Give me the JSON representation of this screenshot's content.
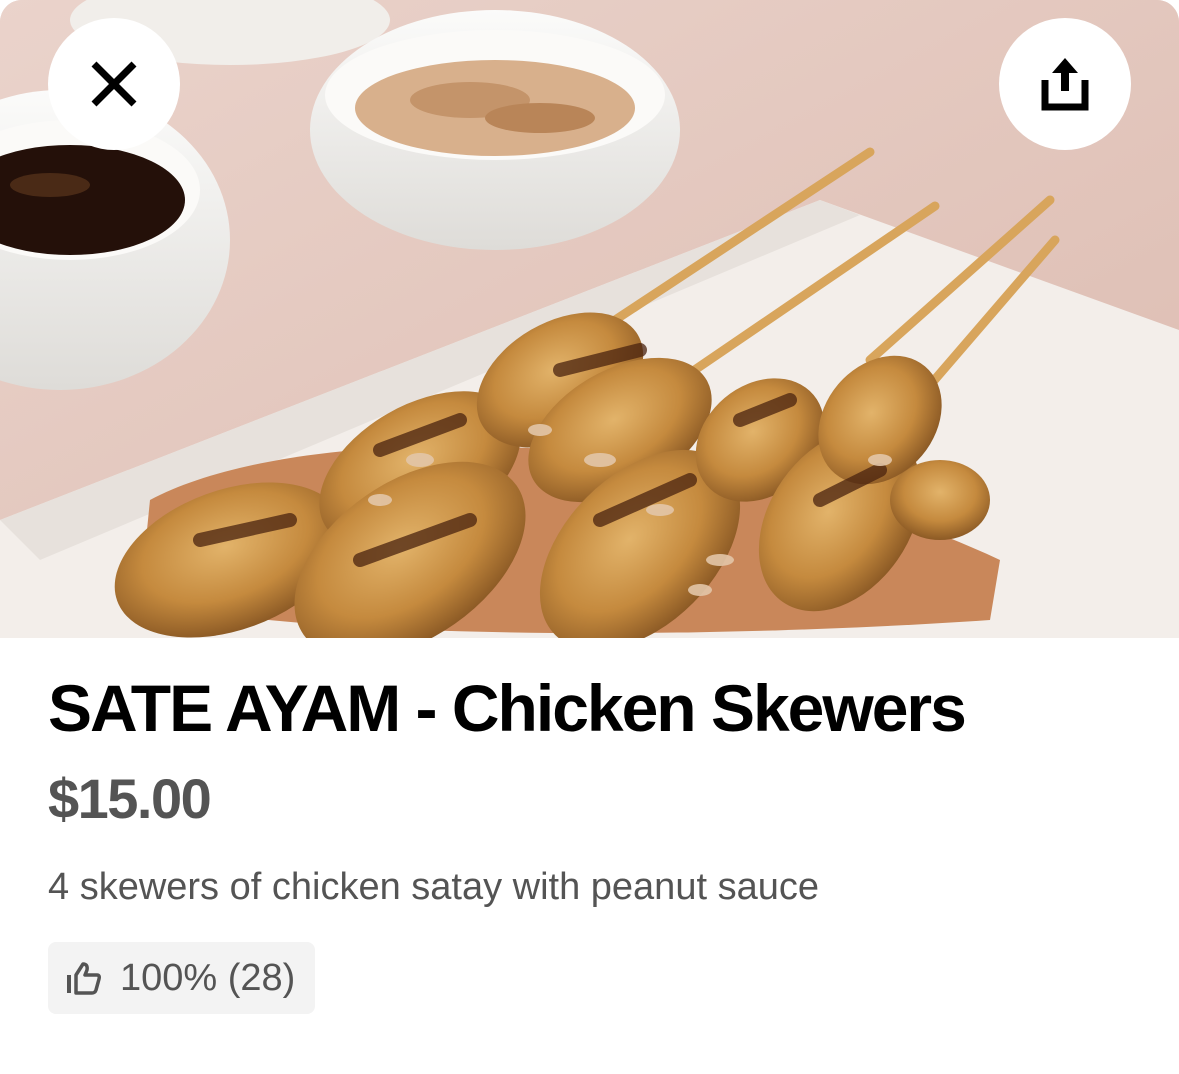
{
  "item": {
    "name": "SATE AYAM - Chicken Skewers",
    "price": "$15.00",
    "description": "4 skewers of chicken satay with peanut sauce",
    "rating": "100% (28)"
  },
  "hero": {
    "subject": "chicken satay skewers with peanut sauce and dipping bowls"
  },
  "icons": {
    "close": "close-icon",
    "share": "share-icon",
    "rating": "thumbs-up-icon"
  },
  "colors": {
    "title": "#000000",
    "price": "#545454",
    "secondary_text": "#545454",
    "badge_bg": "#f3f3f3",
    "button_bg": "#ffffff"
  }
}
